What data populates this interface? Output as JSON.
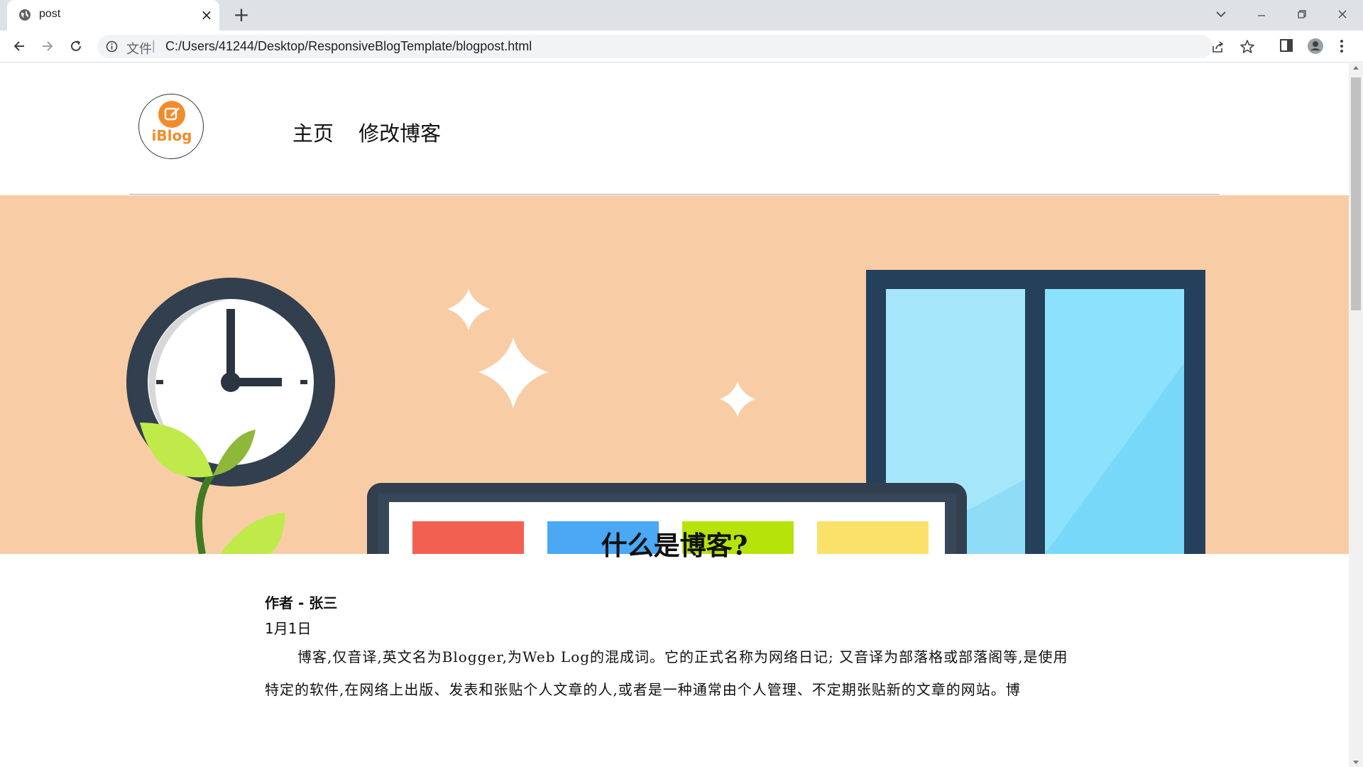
{
  "browser": {
    "tab_title": "post",
    "tab_close": "×",
    "new_tab": "+",
    "address_scheme": "文件",
    "address_sep": "|",
    "url": "C:/Users/41244/Desktop/ResponsiveBlogTemplate/blogpost.html"
  },
  "site": {
    "logo_text": "iBlog",
    "nav": [
      {
        "label": "主页"
      },
      {
        "label": "修改博客"
      }
    ]
  },
  "post": {
    "title": "什么是博客?",
    "author": "作者 - 张三",
    "date": "1月1日",
    "body": "博客,仅音译,英文名为Blogger,为Web Log的混成词。它的正式名称为网络日记; 又音译为部落格或部落阁等,是使用特定的软件,在网络上出版、发表和张贴个人文章的人,或者是一种通常由个人管理、不定期张贴新的文章的网站。博"
  },
  "hero": {
    "bg": "#f8cda5",
    "bar_colors": [
      "#f26052",
      "#4aa8f5",
      "#b6e30a",
      "#fae26a"
    ]
  }
}
